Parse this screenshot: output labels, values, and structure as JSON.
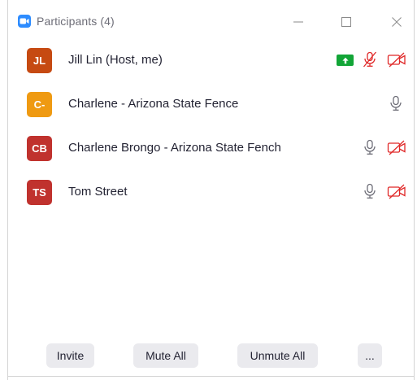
{
  "window": {
    "title": "Participants (4)",
    "controls": [
      "minimize-icon",
      "maximize-icon",
      "close-icon"
    ]
  },
  "colors": {
    "accent": "#2d8cff",
    "muted_red": "#e02828",
    "share_green": "#12a537",
    "button_bg": "#eaeaee"
  },
  "participants": [
    {
      "initials": "JL",
      "name": "Jill Lin (Host, me)",
      "avatar_color": "#c64a12",
      "sharing_screen": true,
      "mic": "muted",
      "video": "off"
    },
    {
      "initials": "C-",
      "name": "Charlene - Arizona State Fence",
      "avatar_color": "#ef9a12",
      "sharing_screen": false,
      "mic": "on",
      "video": "none"
    },
    {
      "initials": "CB",
      "name": "Charlene Brongo - Arizona State Fench",
      "avatar_color": "#c0322e",
      "sharing_screen": false,
      "mic": "on",
      "video": "off"
    },
    {
      "initials": "TS",
      "name": "Tom Street",
      "avatar_color": "#c0322e",
      "sharing_screen": false,
      "mic": "on",
      "video": "off"
    }
  ],
  "footer": {
    "invite_label": "Invite",
    "mute_all_label": "Mute All",
    "unmute_all_label": "Unmute All",
    "more_label": "..."
  }
}
